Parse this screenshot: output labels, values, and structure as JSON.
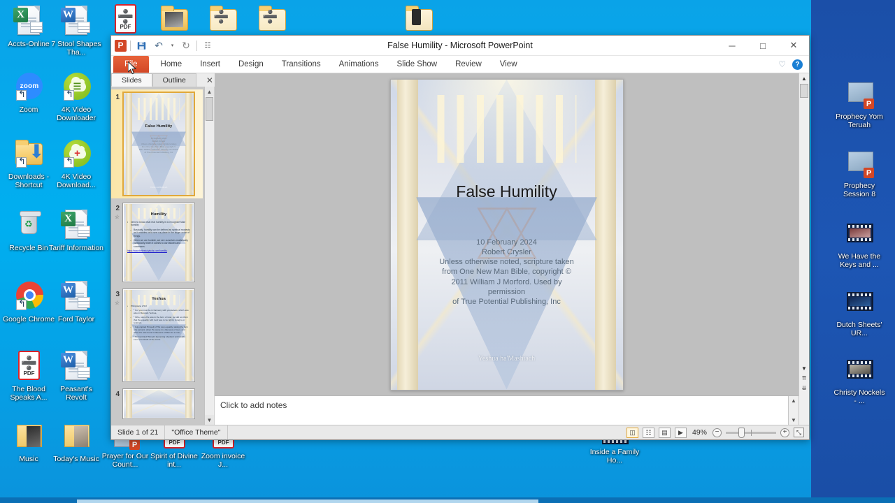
{
  "desktop": {
    "background_color": "#00aff0",
    "right_panel_color": "#1d56b4",
    "icons_left": [
      {
        "label": "Accts-Online",
        "type": "excel-doc"
      },
      {
        "label": "7 Stool Shapes Tha...",
        "type": "word-doc"
      },
      {
        "label": "Zoom",
        "type": "zoom-app"
      },
      {
        "label": "4K Video Downloader",
        "type": "4k-video"
      },
      {
        "label": "Downloads - Shortcut",
        "type": "folder-download"
      },
      {
        "label": "4K Video Download...",
        "type": "4k-video-plus"
      },
      {
        "label": "Recycle Bin",
        "type": "recycle-bin"
      },
      {
        "label": "Tariff Information",
        "type": "excel-doc"
      },
      {
        "label": "Google Chrome",
        "type": "chrome"
      },
      {
        "label": "Ford Taylor",
        "type": "word-doc"
      },
      {
        "label": "The Blood Speaks A...",
        "type": "pdf"
      },
      {
        "label": "Peasant's Revolt",
        "type": "word-doc"
      },
      {
        "label": "Music",
        "type": "music-folder"
      },
      {
        "label": "Today's Music",
        "type": "music-folder"
      }
    ],
    "icons_top_strip": [
      {
        "label": "",
        "type": "pdf"
      },
      {
        "label": "",
        "type": "folder-photo"
      },
      {
        "label": "",
        "type": "folder-pdf"
      },
      {
        "label": "",
        "type": "folder-pdf"
      },
      {
        "label": "",
        "type": "folder-media"
      }
    ],
    "icons_bottom_strip": [
      {
        "label": "Prayer for Our Count...",
        "type": "ppt"
      },
      {
        "label": "Spirit of Divine int...",
        "type": "pdf"
      },
      {
        "label": "Zoom invoice J...",
        "type": "pdf"
      },
      {
        "label": "Inside a Family Ho...",
        "type": "video"
      }
    ],
    "icons_right": [
      {
        "label": "Prophecy Yom Teruah",
        "type": "ppt-video"
      },
      {
        "label": "Prophecy Session 8",
        "type": "ppt-video"
      },
      {
        "label": "We Have the Keys and ...",
        "type": "video"
      },
      {
        "label": "Dutch Sheets' UR...",
        "type": "video"
      },
      {
        "label": "Christy Nockels - ...",
        "type": "video"
      }
    ]
  },
  "window": {
    "title": "False Humility  -  Microsoft PowerPoint",
    "minimize": "─",
    "maximize": "□",
    "close": "✕",
    "quick_access": {
      "app_logo": "P",
      "save": "save-icon",
      "undo": "↶",
      "undo_arrow": "▾",
      "redo": "↻",
      "customize": "☷"
    }
  },
  "ribbon": {
    "tabs": [
      "File",
      "Home",
      "Insert",
      "Design",
      "Transitions",
      "Animations",
      "Slide Show",
      "Review",
      "View"
    ],
    "active_tab": "File",
    "heart_icon": "♡",
    "help_label": "?"
  },
  "slides_pane": {
    "tabs": [
      "Slides",
      "Outline"
    ],
    "active_tab": "Slides",
    "close_label": "✕",
    "thumbnails": [
      {
        "number": "1",
        "selected": true,
        "title": "False Humility",
        "lines": [
          "10 February 2024",
          "Robert Crysler",
          "Unless otherwise noted, scripture taken",
          "from One New Man Bible, copyright ©",
          "2011 William J Morford.  Used by permission",
          "of  True Potential Publishing,  Inc"
        ],
        "footer": "Yeshua ha'Mashiach"
      },
      {
        "number": "2",
        "selected": false,
        "star": "☆",
        "title": "Humility",
        "bullets": [
          {
            "level": 1,
            "text": "need  to know what real humility is  to  recognize false humility"
          },
          {
            "level": 2,
            "text": "Basically, humility can be defined as spiritual  modesty as it enables us to see our place in  the larger order of things."
          },
          {
            "level": 2,
            "text": "When we are humble, we see ourselves realistically, particularly when it comes to our failures and successes."
          }
        ],
        "link": "https://www.biblestudytools.com/humility"
      },
      {
        "number": "3",
        "selected": false,
        "star": "☆",
        "title": "Yeshua",
        "bullets": [
          {
            "level": 1,
            "text": "Philippians  2:5-8"
          },
          {
            "level": 2,
            "text": "⁵ For you must be in harmony with yourselves, which was also in Messiah Yeshua,"
          },
          {
            "level": 2,
            "text": "⁶ Who, since He was in the form of God, yet did not think that the equality with God was to be tightly  clung to  or retained,"
          },
          {
            "level": 2,
            "text": "⁷ but emptied Himself  of  His own equality, taking the form of a servant, when He came in a likeness of men,  and when He was found in likeness of Man as a man,"
          },
          {
            "level": 2,
            "text": "⁸ He humbled Himself,  becoming obedient until death, even  of a death of the cross."
          }
        ]
      },
      {
        "number": "4",
        "selected": false,
        "title": "",
        "bullets": []
      }
    ]
  },
  "slide": {
    "title": "False Humility",
    "subtitle_lines": [
      "10 February 2024",
      "Robert Crysler",
      "Unless  otherwise  noted,  scripture  taken",
      "from  One New Man Bible,  copyright  ©",
      "2011  William  J  Morford.   Used  by",
      "permission",
      "of  True Potential Publishing,  Inc"
    ],
    "footer": "Yeshua ha'Mashiach"
  },
  "notes": {
    "placeholder": "Click to add notes"
  },
  "statusbar": {
    "slide_counter": "Slide 1 of 21",
    "theme": "\"Office Theme\"",
    "zoom_value": "49%",
    "zoom_out": "−",
    "zoom_in": "+",
    "fit_label": "⤡",
    "view_buttons": [
      {
        "name": "normal-view",
        "glyph": "◫",
        "active": true
      },
      {
        "name": "slide-sorter-view",
        "glyph": "☷",
        "active": false
      },
      {
        "name": "reading-view",
        "glyph": "▤",
        "active": false
      },
      {
        "name": "slide-show-view",
        "glyph": "▶",
        "active": false
      }
    ]
  },
  "scroll": {
    "up_arrow": "▲",
    "down_arrow": "▼",
    "prev_slide": "⇈",
    "next_slide": "⇊"
  }
}
